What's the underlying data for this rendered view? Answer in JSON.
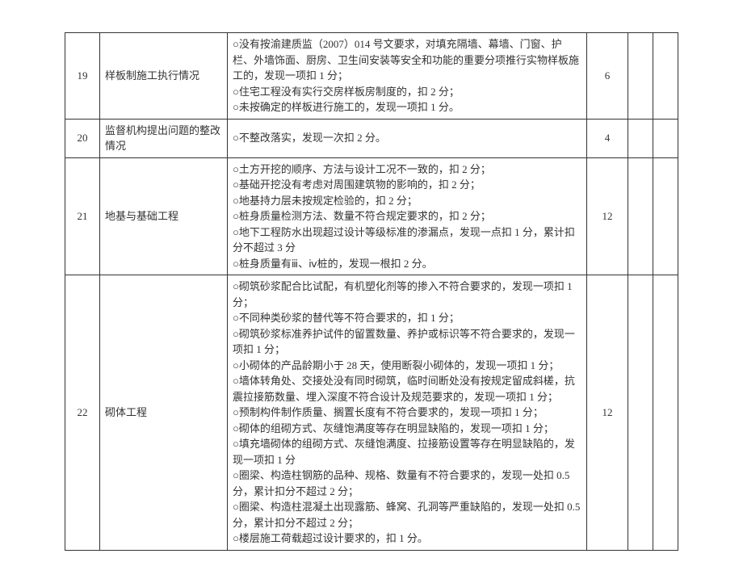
{
  "rows": [
    {
      "num": "19",
      "name": "样板制施工执行情况",
      "desc": [
        "○没有按渝建质监（2007）014 号文要求，对填充隔墙、幕墙、门窗、护栏、外墙饰面、厨房、卫生间安装等安全和功能的重要分项推行实物样板施工的，发现一项扣 1 分；",
        "○住宅工程没有实行交房样板房制度的，扣 2 分；",
        "○未按确定的样板进行施工的，发现一项扣 1 分。"
      ],
      "score": "6"
    },
    {
      "num": "20",
      "name": "监督机构提出问题的整改情况",
      "desc": [
        "○不整改落实，发现一次扣 2 分。"
      ],
      "score": "4"
    },
    {
      "num": "21",
      "name": "地基与基础工程",
      "desc": [
        "○土方开挖的顺序、方法与设计工况不一致的，扣 2 分；",
        "○基础开挖没有考虑对周围建筑物的影响的，扣 2 分；",
        "○地基持力层未按规定检验的，扣 2 分；",
        "○桩身质量检测方法、数量不符合规定要求的，扣 2 分；",
        "○地下工程防水出现超过设计等级标准的渗漏点，发现一点扣 1 分，累计扣分不超过 3 分",
        "○桩身质量有ⅲ、ⅳ桩的，发现一根扣 2 分。"
      ],
      "score": "12"
    },
    {
      "num": "22",
      "name": "砌体工程",
      "desc": [
        "○砌筑砂浆配合比试配，有机塑化剂等的掺入不符合要求的，发现一项扣 1 分；",
        "○不同种类砂浆的替代等不符合要求的，扣 1 分；",
        "○砌筑砂浆标准养护试件的留置数量、养护或标识等不符合要求的，发现一项扣 1 分；",
        "○小砌体的产品龄期小于 28 天，使用断裂小砌体的，发现一项扣 1 分；",
        "○墙体转角处、交接处没有同时砌筑，临时间断处没有按规定留成斜槎，抗震拉接筋数量、埋入深度不符合设计及规范要求的，发现一项扣 1 分；",
        "○预制构件制作质量、搁置长度有不符合要求的，发现一项扣 1 分；",
        "○砌体的组砌方式、灰缝饱满度等存在明显缺陷的，发现一项扣 1 分；",
        "○填充墙砌体的组砌方式、灰缝饱满度、拉接筋设置等存在明显缺陷的，发现一项扣 1 分",
        "○圈梁、构造柱钢筋的品种、规格、数量有不符合要求的，发现一处扣 0.5 分，累计扣分不超过 2 分；",
        "○圈梁、构造柱混凝土出现露筋、蜂窝、孔洞等严重缺陷的，发现一处扣 0.5 分，累计扣分不超过 2 分；",
        "○楼层施工荷载超过设计要求的，扣 1 分。"
      ],
      "score": "12"
    }
  ]
}
